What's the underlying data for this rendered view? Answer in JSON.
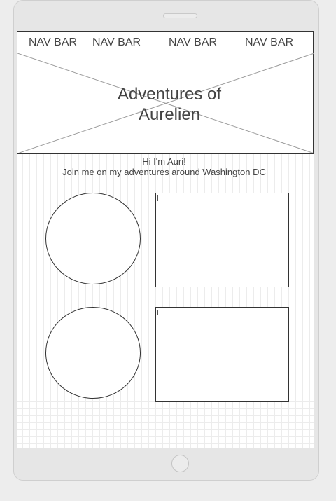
{
  "navbar": {
    "items": [
      {
        "label": "NAV BAR"
      },
      {
        "label": "NAV BAR"
      },
      {
        "label": "NAV BAR"
      },
      {
        "label": "NAV BAR"
      }
    ]
  },
  "hero": {
    "title": "Adventures of\nAurelien"
  },
  "intro": {
    "greeting": "Hi I'm Auri!",
    "tagline": "Join me on my adventures around Washington DC"
  },
  "content": {
    "text_boxes": [
      {
        "value": ""
      },
      {
        "value": ""
      }
    ]
  },
  "colors": {
    "stroke": "#333333",
    "text": "#444444",
    "device": "#e6e6e6",
    "grid": "#ececec"
  }
}
